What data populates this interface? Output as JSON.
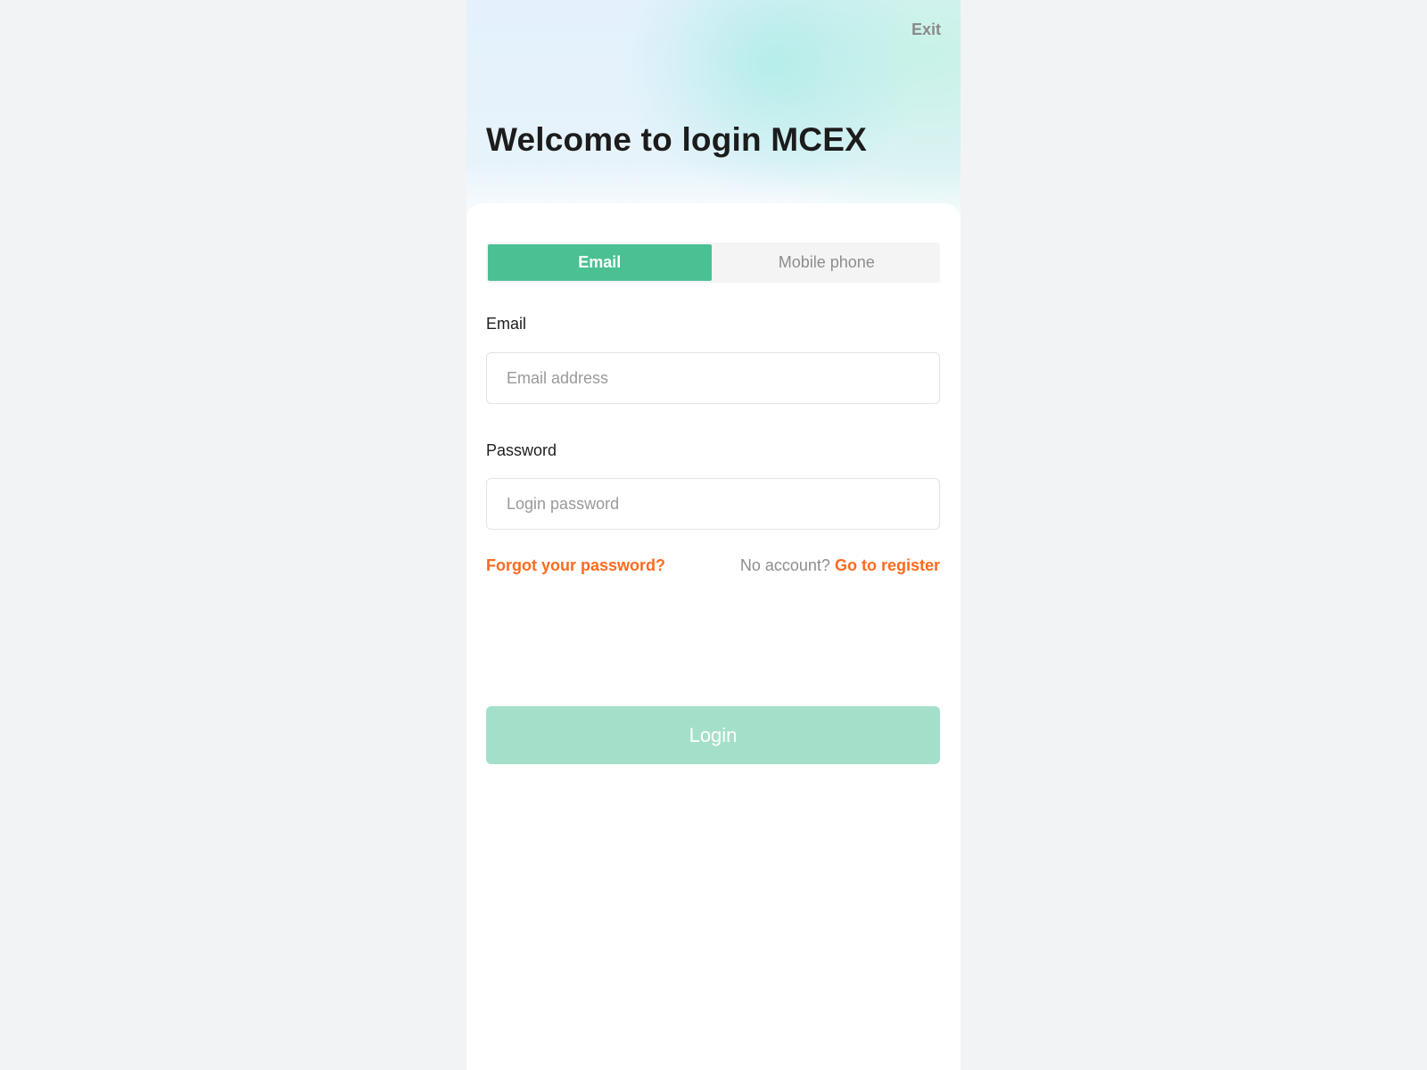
{
  "header": {
    "exit_label": "Exit",
    "title": "Welcome to login MCEX"
  },
  "tabs": [
    {
      "label": "Email",
      "active": true
    },
    {
      "label": "Mobile phone",
      "active": false
    }
  ],
  "form": {
    "email": {
      "label": "Email",
      "value": "",
      "placeholder": "Email address"
    },
    "password": {
      "label": "Password",
      "value": "",
      "placeholder": "Login password"
    }
  },
  "links": {
    "forgot": "Forgot your password?",
    "no_account": "No account?",
    "register": "Go to register"
  },
  "login_button": "Login",
  "colors": {
    "page_bg": "#f2f3f5",
    "accent": "#4bc193",
    "accent_disabled": "#a4e0c9",
    "link": "#ff6a1f"
  }
}
